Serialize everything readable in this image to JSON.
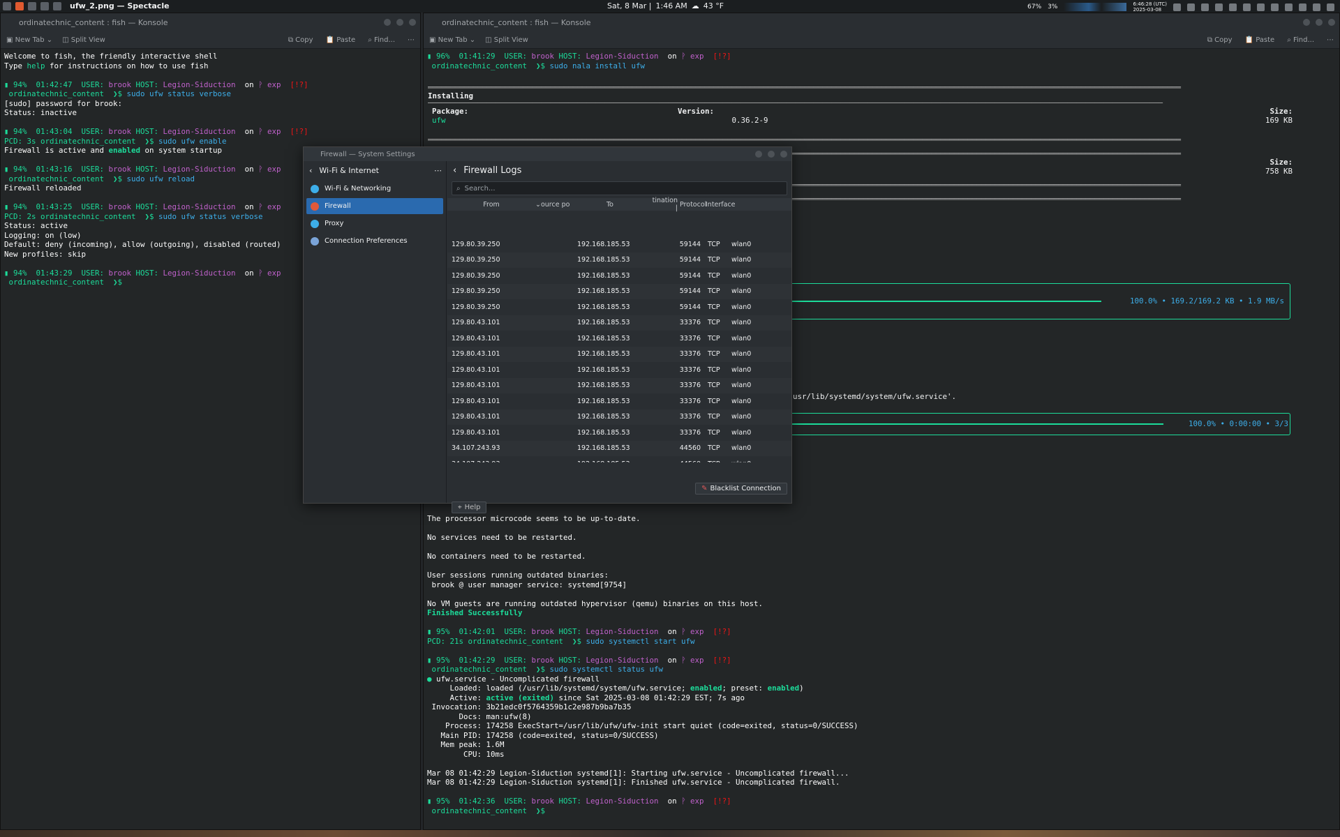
{
  "topbar": {
    "app_title": "ufw_2.png — Spectacle",
    "date": "Sat, 8 Mar |",
    "time": "1:46 AM",
    "weather": "43 °F",
    "cpu1": "67%",
    "cpu2": "3%",
    "utc_time": "6:46:28 (UTC)",
    "utc_date": "2025-03-08"
  },
  "left_term": {
    "title": "ordinatechnic_content : fish — Konsole",
    "new_tab": "New Tab",
    "split_view": "Split View",
    "copy": "Copy",
    "paste": "Paste",
    "find": "Find..."
  },
  "right_term": {
    "title": "ordinatechnic_content : fish — Konsole",
    "new_tab": "New Tab",
    "split_view": "Split View",
    "copy": "Copy",
    "paste": "Paste",
    "find": "Find..."
  },
  "left_lines": [
    "Welcome to fish, the friendly interactive shell",
    "Type help for instructions on how to use fish",
    "",
    "▮ 94%  01:42:47  USER: brook HOST: Legion-Siduction  on ᚹ exp  [!?]",
    " ordinatechnic_content  ❯$ sudo ufw status verbose",
    "[sudo] password for brook:",
    "Status: inactive",
    "",
    "▮ 94%  01:43:04  USER: brook HOST: Legion-Siduction  on ᚹ exp  [!?]",
    "PCD: 3s ordinatechnic_content  ❯$ sudo ufw enable",
    "Firewall is active and enabled on system startup",
    "",
    "▮ 94%  01:43:16  USER: brook HOST: Legion-Siduction  on ᚹ exp",
    " ordinatechnic_content  ❯$ sudo ufw reload",
    "Firewall reloaded",
    "",
    "▮ 94%  01:43:25  USER: brook HOST: Legion-Siduction  on ᚹ exp",
    "PCD: 2s ordinatechnic_content  ❯$ sudo ufw status verbose",
    "Status: active",
    "Logging: on (low)",
    "Default: deny (incoming), allow (outgoing), disabled (routed)",
    "New profiles: skip",
    "",
    "▮ 94%  01:43:29  USER: brook HOST: Legion-Siduction  on ᚹ exp",
    " ordinatechnic_content  ❯$ "
  ],
  "right_top_lines": [
    "▮ 96%  01:41:29  USER: brook HOST: Legion-Siduction  on ᚹ exp  [!?]",
    " ordinatechnic_content  ❯$ sudo nala install ufw"
  ],
  "install": {
    "installing": "Installing",
    "package_h": "Package:",
    "version_h": "Version:",
    "size_h": "Size:",
    "pkg": "ufw",
    "ver": "0.36.2-9",
    "size": "169 KB",
    "size2_h": "Size:",
    "size2": "758 KB"
  },
  "progress1": "100.0% • 169.2/169.2 KB • 1.9 MB/s",
  "service_path": "usr/lib/systemd/system/ufw.service'.",
  "progress2": "100.0% • 0:00:00 • 3/3",
  "right_bottom_lines": [
    "The processor microcode seems to be up-to-date.",
    "",
    "No services need to be restarted.",
    "",
    "No containers need to be restarted.",
    "",
    "User sessions running outdated binaries:",
    " brook @ user manager service: systemd[9754]",
    "",
    "No VM guests are running outdated hypervisor (qemu) binaries on this host.",
    "Finished Successfully",
    "",
    "▮ 95%  01:42:01  USER: brook HOST: Legion-Siduction  on ᚹ exp  [!?]",
    "PCD: 21s ordinatechnic_content  ❯$ sudo systemctl start ufw",
    "",
    "▮ 95%  01:42:29  USER: brook HOST: Legion-Siduction  on ᚹ exp  [!?]",
    " ordinatechnic_content  ❯$ sudo systemctl status ufw",
    "● ufw.service - Uncomplicated firewall",
    "     Loaded: loaded (/usr/lib/systemd/system/ufw.service; enabled; preset: enabled)",
    "     Active: active (exited) since Sat 2025-03-08 01:42:29 EST; 7s ago",
    " Invocation: 3b21edc0f5764359b1c2e987b9ba7b35",
    "       Docs: man:ufw(8)",
    "    Process: 174258 ExecStart=/usr/lib/ufw/ufw-init start quiet (code=exited, status=0/SUCCESS)",
    "   Main PID: 174258 (code=exited, status=0/SUCCESS)",
    "   Mem peak: 1.6M",
    "        CPU: 10ms",
    "",
    "Mar 08 01:42:29 Legion-Siduction systemd[1]: Starting ufw.service - Uncomplicated firewall...",
    "Mar 08 01:42:29 Legion-Siduction systemd[1]: Finished ufw.service - Uncomplicated firewall.",
    "",
    "▮ 95%  01:42:36  USER: brook HOST: Legion-Siduction  on ᚹ exp  [!?]",
    " ordinatechnic_content  ❯$ "
  ],
  "dialog": {
    "title": "Firewall — System Settings",
    "back_label": "Wi-Fi & Internet",
    "page_title": "Firewall Logs",
    "search_placeholder": "Search...",
    "sidebar": [
      {
        "label": "Wi-Fi & Networking",
        "icon": "wifi-icon"
      },
      {
        "label": "Firewall",
        "icon": "firewall-icon"
      },
      {
        "label": "Proxy",
        "icon": "proxy-icon"
      },
      {
        "label": "Connection Preferences",
        "icon": "connection-icon"
      }
    ],
    "columns": [
      "From",
      "ource po",
      "To",
      "tination |",
      "Protocol",
      "Interface"
    ],
    "rows": [
      [
        "129.80.39.250",
        "192.168.185.53",
        "59144",
        "TCP",
        "wlan0"
      ],
      [
        "129.80.39.250",
        "192.168.185.53",
        "59144",
        "TCP",
        "wlan0"
      ],
      [
        "129.80.39.250",
        "192.168.185.53",
        "59144",
        "TCP",
        "wlan0"
      ],
      [
        "129.80.39.250",
        "192.168.185.53",
        "59144",
        "TCP",
        "wlan0"
      ],
      [
        "129.80.39.250",
        "192.168.185.53",
        "59144",
        "TCP",
        "wlan0"
      ],
      [
        "129.80.43.101",
        "192.168.185.53",
        "33376",
        "TCP",
        "wlan0"
      ],
      [
        "129.80.43.101",
        "192.168.185.53",
        "33376",
        "TCP",
        "wlan0"
      ],
      [
        "129.80.43.101",
        "192.168.185.53",
        "33376",
        "TCP",
        "wlan0"
      ],
      [
        "129.80.43.101",
        "192.168.185.53",
        "33376",
        "TCP",
        "wlan0"
      ],
      [
        "129.80.43.101",
        "192.168.185.53",
        "33376",
        "TCP",
        "wlan0"
      ],
      [
        "129.80.43.101",
        "192.168.185.53",
        "33376",
        "TCP",
        "wlan0"
      ],
      [
        "129.80.43.101",
        "192.168.185.53",
        "33376",
        "TCP",
        "wlan0"
      ],
      [
        "129.80.43.101",
        "192.168.185.53",
        "33376",
        "TCP",
        "wlan0"
      ],
      [
        "34.107.243.93",
        "192.168.185.53",
        "44560",
        "TCP",
        "wlan0"
      ],
      [
        "34.107.243.93",
        "192.168.185.53",
        "44560",
        "TCP",
        "wlan0"
      ]
    ],
    "blacklist": "Blacklist Connection",
    "help": "Help"
  }
}
